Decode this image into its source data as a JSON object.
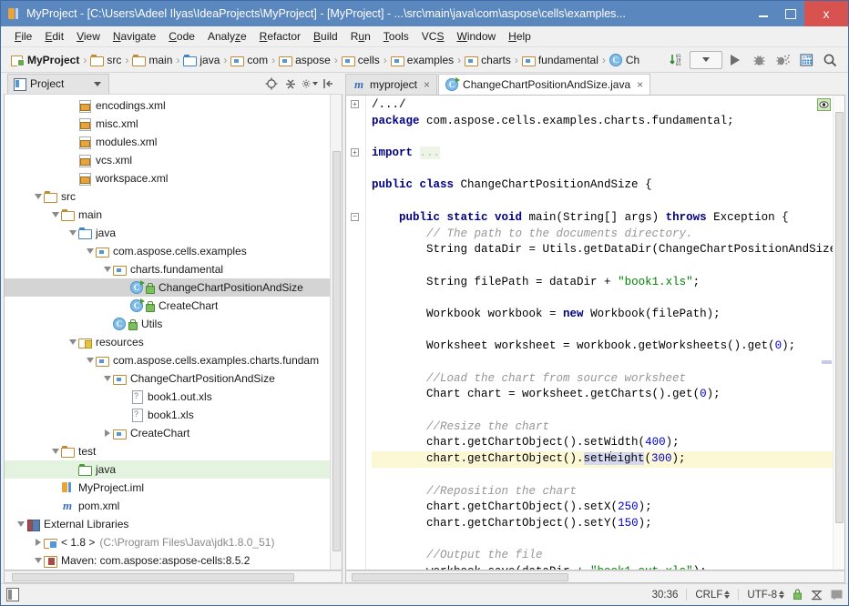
{
  "window": {
    "title": "MyProject - [C:\\Users\\Adeel Ilyas\\IdeaProjects\\MyProject] - [MyProject] - ...\\src\\main\\java\\com\\aspose\\cells\\examples...",
    "minimize_label": "",
    "maximize_label": "",
    "close_label": "x"
  },
  "menubar": [
    {
      "label": "File",
      "mnemonic": "F"
    },
    {
      "label": "Edit",
      "mnemonic": "E"
    },
    {
      "label": "View",
      "mnemonic": "V"
    },
    {
      "label": "Navigate",
      "mnemonic": "N"
    },
    {
      "label": "Code",
      "mnemonic": "C"
    },
    {
      "label": "Analyze",
      "mnemonic": "z"
    },
    {
      "label": "Refactor",
      "mnemonic": "R"
    },
    {
      "label": "Build",
      "mnemonic": "B"
    },
    {
      "label": "Run",
      "mnemonic": "u"
    },
    {
      "label": "Tools",
      "mnemonic": "T"
    },
    {
      "label": "VCS",
      "mnemonic": "S"
    },
    {
      "label": "Window",
      "mnemonic": "W"
    },
    {
      "label": "Help",
      "mnemonic": "H"
    }
  ],
  "breadcrumb": [
    {
      "label": "MyProject",
      "icon": "module-icon",
      "bold": true
    },
    {
      "label": "src",
      "icon": "folder-icon",
      "bold": false
    },
    {
      "label": "main",
      "icon": "folder-icon",
      "bold": false
    },
    {
      "label": "java",
      "icon": "folder-blue-icon",
      "bold": false
    },
    {
      "label": "com",
      "icon": "package-icon",
      "bold": false
    },
    {
      "label": "aspose",
      "icon": "package-icon",
      "bold": false
    },
    {
      "label": "cells",
      "icon": "package-icon",
      "bold": false
    },
    {
      "label": "examples",
      "icon": "package-icon",
      "bold": false
    },
    {
      "label": "charts",
      "icon": "package-icon",
      "bold": false
    },
    {
      "label": "fundamental",
      "icon": "package-icon",
      "bold": false
    },
    {
      "label": "Ch",
      "icon": "class-icon",
      "bold": false
    }
  ],
  "toolbar": {
    "sort_label": "",
    "run_config_label": "",
    "run_label": "",
    "debug_label": "",
    "coverage_label": "",
    "database_label": "",
    "search_label": ""
  },
  "project_panel": {
    "tab_label": "Project",
    "tree": [
      {
        "label": "encodings.xml",
        "indent": 3,
        "icon": "xml-file-icon",
        "twist": "none",
        "state": "normal"
      },
      {
        "label": "misc.xml",
        "indent": 3,
        "icon": "xml-file-icon",
        "twist": "none",
        "state": "normal"
      },
      {
        "label": "modules.xml",
        "indent": 3,
        "icon": "xml-file-icon",
        "twist": "none",
        "state": "normal"
      },
      {
        "label": "vcs.xml",
        "indent": 3,
        "icon": "xml-file-icon",
        "twist": "none",
        "state": "normal"
      },
      {
        "label": "workspace.xml",
        "indent": 3,
        "icon": "xml-file-icon",
        "twist": "none",
        "state": "normal"
      },
      {
        "label": "src",
        "indent": 1,
        "icon": "folder-icon",
        "twist": "open",
        "state": "normal"
      },
      {
        "label": "main",
        "indent": 2,
        "icon": "folder-icon",
        "twist": "open",
        "state": "normal"
      },
      {
        "label": "java",
        "indent": 3,
        "icon": "folder-blue-icon",
        "twist": "open",
        "state": "normal"
      },
      {
        "label": "com.aspose.cells.examples",
        "indent": 4,
        "icon": "package-icon",
        "twist": "open",
        "state": "normal"
      },
      {
        "label": "charts.fundamental",
        "indent": 5,
        "icon": "package-icon",
        "twist": "open",
        "state": "normal"
      },
      {
        "label": "ChangeChartPositionAndSize",
        "indent": 6,
        "icon": "class-runnable-icon",
        "twist": "none",
        "state": "selected",
        "lock": true
      },
      {
        "label": "CreateChart",
        "indent": 6,
        "icon": "class-runnable-icon",
        "twist": "none",
        "state": "normal",
        "lock": true
      },
      {
        "label": "Utils",
        "indent": 6,
        "icon": "class-icon",
        "twist": "none",
        "state": "normal",
        "lock": true,
        "shift": -1
      },
      {
        "label": "resources",
        "indent": 3,
        "icon": "resources-icon",
        "twist": "open",
        "state": "normal"
      },
      {
        "label": "com.aspose.cells.examples.charts.fundam",
        "indent": 4,
        "icon": "package-icon",
        "twist": "open",
        "state": "normal"
      },
      {
        "label": "ChangeChartPositionAndSize",
        "indent": 5,
        "icon": "package-icon",
        "twist": "open",
        "state": "normal"
      },
      {
        "label": "book1.out.xls",
        "indent": 6,
        "icon": "unknown-file-icon",
        "twist": "none",
        "state": "normal"
      },
      {
        "label": "book1.xls",
        "indent": 6,
        "icon": "unknown-file-icon",
        "twist": "none",
        "state": "normal"
      },
      {
        "label": "CreateChart",
        "indent": 5,
        "icon": "package-icon",
        "twist": "closed",
        "state": "normal"
      },
      {
        "label": "test",
        "indent": 2,
        "icon": "folder-icon",
        "twist": "open",
        "state": "normal"
      },
      {
        "label": "java",
        "indent": 3,
        "icon": "folder-green-icon",
        "twist": "none",
        "state": "green"
      },
      {
        "label": "MyProject.iml",
        "indent": 2,
        "icon": "iml-file-icon",
        "twist": "none",
        "state": "normal"
      },
      {
        "label": "pom.xml",
        "indent": 2,
        "icon": "maven-m-icon",
        "twist": "none",
        "state": "normal"
      },
      {
        "label": "External Libraries",
        "indent": 0,
        "icon": "library-icon",
        "twist": "open",
        "state": "normal"
      },
      {
        "label": "< 1.8 >",
        "indent": 1,
        "icon": "jdk-icon",
        "twist": "closed",
        "state": "normal",
        "suffix": "(C:\\Program Files\\Java\\jdk1.8.0_51)"
      },
      {
        "label": "Maven: com.aspose:aspose-cells:8.5.2",
        "indent": 1,
        "icon": "maven-module-icon",
        "twist": "open",
        "state": "normal"
      }
    ]
  },
  "editor": {
    "tabs": [
      {
        "label": "myproject",
        "icon": "maven-m-icon",
        "active": false
      },
      {
        "label": "ChangeChartPositionAndSize.java",
        "icon": "class-runnable-icon",
        "active": true
      }
    ],
    "code_lines": [
      {
        "type": "fold",
        "text": "/.../",
        "gutter": "plus"
      },
      {
        "type": "plain",
        "segments": [
          {
            "t": "package ",
            "c": "kw"
          },
          {
            "t": "com.aspose.cells.examples.charts.fundamental;",
            "c": "none"
          }
        ]
      },
      {
        "type": "blank"
      },
      {
        "type": "import",
        "segments": [
          {
            "t": "import ",
            "c": "kw"
          },
          {
            "t": "...",
            "c": "fold"
          }
        ],
        "gutter": "plus"
      },
      {
        "type": "blank"
      },
      {
        "type": "plain",
        "segments": [
          {
            "t": "public class ",
            "c": "kw"
          },
          {
            "t": "ChangeChartPositionAndSize {",
            "c": "none"
          }
        ]
      },
      {
        "type": "blank"
      },
      {
        "type": "plain",
        "indent": 1,
        "segments": [
          {
            "t": "public static void ",
            "c": "kw"
          },
          {
            "t": "main(String[] args) ",
            "c": "none"
          },
          {
            "t": "throws ",
            "c": "kw"
          },
          {
            "t": "Exception {",
            "c": "none"
          }
        ],
        "gutter": "minus"
      },
      {
        "type": "plain",
        "indent": 2,
        "segments": [
          {
            "t": "// The path to the documents directory.",
            "c": "cmt"
          }
        ]
      },
      {
        "type": "plain",
        "indent": 2,
        "segments": [
          {
            "t": "String dataDir = Utils.getDataDir(ChangeChartPositionAndSize.clas",
            "c": "none"
          }
        ]
      },
      {
        "type": "blank"
      },
      {
        "type": "plain",
        "indent": 2,
        "segments": [
          {
            "t": "String filePath = dataDir + ",
            "c": "none"
          },
          {
            "t": "\"book1.xls\"",
            "c": "str"
          },
          {
            "t": ";",
            "c": "none"
          }
        ]
      },
      {
        "type": "blank"
      },
      {
        "type": "plain",
        "indent": 2,
        "segments": [
          {
            "t": "Workbook workbook = ",
            "c": "none"
          },
          {
            "t": "new ",
            "c": "kw"
          },
          {
            "t": "Workbook(filePath);",
            "c": "none"
          }
        ]
      },
      {
        "type": "blank"
      },
      {
        "type": "plain",
        "indent": 2,
        "segments": [
          {
            "t": "Worksheet worksheet = workbook.getWorksheets().get(",
            "c": "none"
          },
          {
            "t": "0",
            "c": "num"
          },
          {
            "t": ");",
            "c": "none"
          }
        ]
      },
      {
        "type": "blank"
      },
      {
        "type": "plain",
        "indent": 2,
        "segments": [
          {
            "t": "//Load the chart from source worksheet",
            "c": "cmt"
          }
        ]
      },
      {
        "type": "plain",
        "indent": 2,
        "segments": [
          {
            "t": "Chart chart = worksheet.getCharts().get(",
            "c": "none"
          },
          {
            "t": "0",
            "c": "num"
          },
          {
            "t": ");",
            "c": "none"
          }
        ]
      },
      {
        "type": "blank"
      },
      {
        "type": "plain",
        "indent": 2,
        "segments": [
          {
            "t": "//Resize the chart",
            "c": "cmt"
          }
        ]
      },
      {
        "type": "plain",
        "indent": 2,
        "segments": [
          {
            "t": "chart.getChartObject().setWidth(",
            "c": "none"
          },
          {
            "t": "400",
            "c": "num"
          },
          {
            "t": ");",
            "c": "none"
          }
        ]
      },
      {
        "type": "caret",
        "indent": 2,
        "highlight": true,
        "segments": [
          {
            "t": "chart.getChartObject().",
            "c": "none"
          },
          {
            "t": "setH",
            "c": "sel"
          },
          {
            "t": "CARET",
            "c": "caret"
          },
          {
            "t": "eight",
            "c": "sel"
          },
          {
            "t": "(",
            "c": "none"
          },
          {
            "t": "300",
            "c": "num"
          },
          {
            "t": ");",
            "c": "none"
          }
        ]
      },
      {
        "type": "blank"
      },
      {
        "type": "plain",
        "indent": 2,
        "segments": [
          {
            "t": "//Reposition the chart",
            "c": "cmt"
          }
        ]
      },
      {
        "type": "plain",
        "indent": 2,
        "segments": [
          {
            "t": "chart.getChartObject().setX(",
            "c": "none"
          },
          {
            "t": "250",
            "c": "num"
          },
          {
            "t": ");",
            "c": "none"
          }
        ]
      },
      {
        "type": "plain",
        "indent": 2,
        "segments": [
          {
            "t": "chart.getChartObject().setY(",
            "c": "none"
          },
          {
            "t": "150",
            "c": "num"
          },
          {
            "t": ");",
            "c": "none"
          }
        ]
      },
      {
        "type": "blank"
      },
      {
        "type": "plain",
        "indent": 2,
        "segments": [
          {
            "t": "//Output the file",
            "c": "cmt"
          }
        ]
      },
      {
        "type": "plain",
        "indent": 2,
        "segments": [
          {
            "t": "workbook.save(dataDir + ",
            "c": "none"
          },
          {
            "t": "\"book1.out.xls\"",
            "c": "str"
          },
          {
            "t": ");",
            "c": "none"
          }
        ]
      }
    ]
  },
  "statusbar": {
    "caret_position": "30:36",
    "line_separator": "CRLF",
    "encoding": "UTF-8",
    "lock_label": "",
    "events_label": ""
  },
  "colors": {
    "titlebar": "#5b87bf",
    "close_button": "#d8534f",
    "selection": "#d4d4d4",
    "line_highlight": "#fcf7d4",
    "keyword": "#000080",
    "string": "#008000",
    "number": "#0000cc",
    "comment": "#969696"
  }
}
